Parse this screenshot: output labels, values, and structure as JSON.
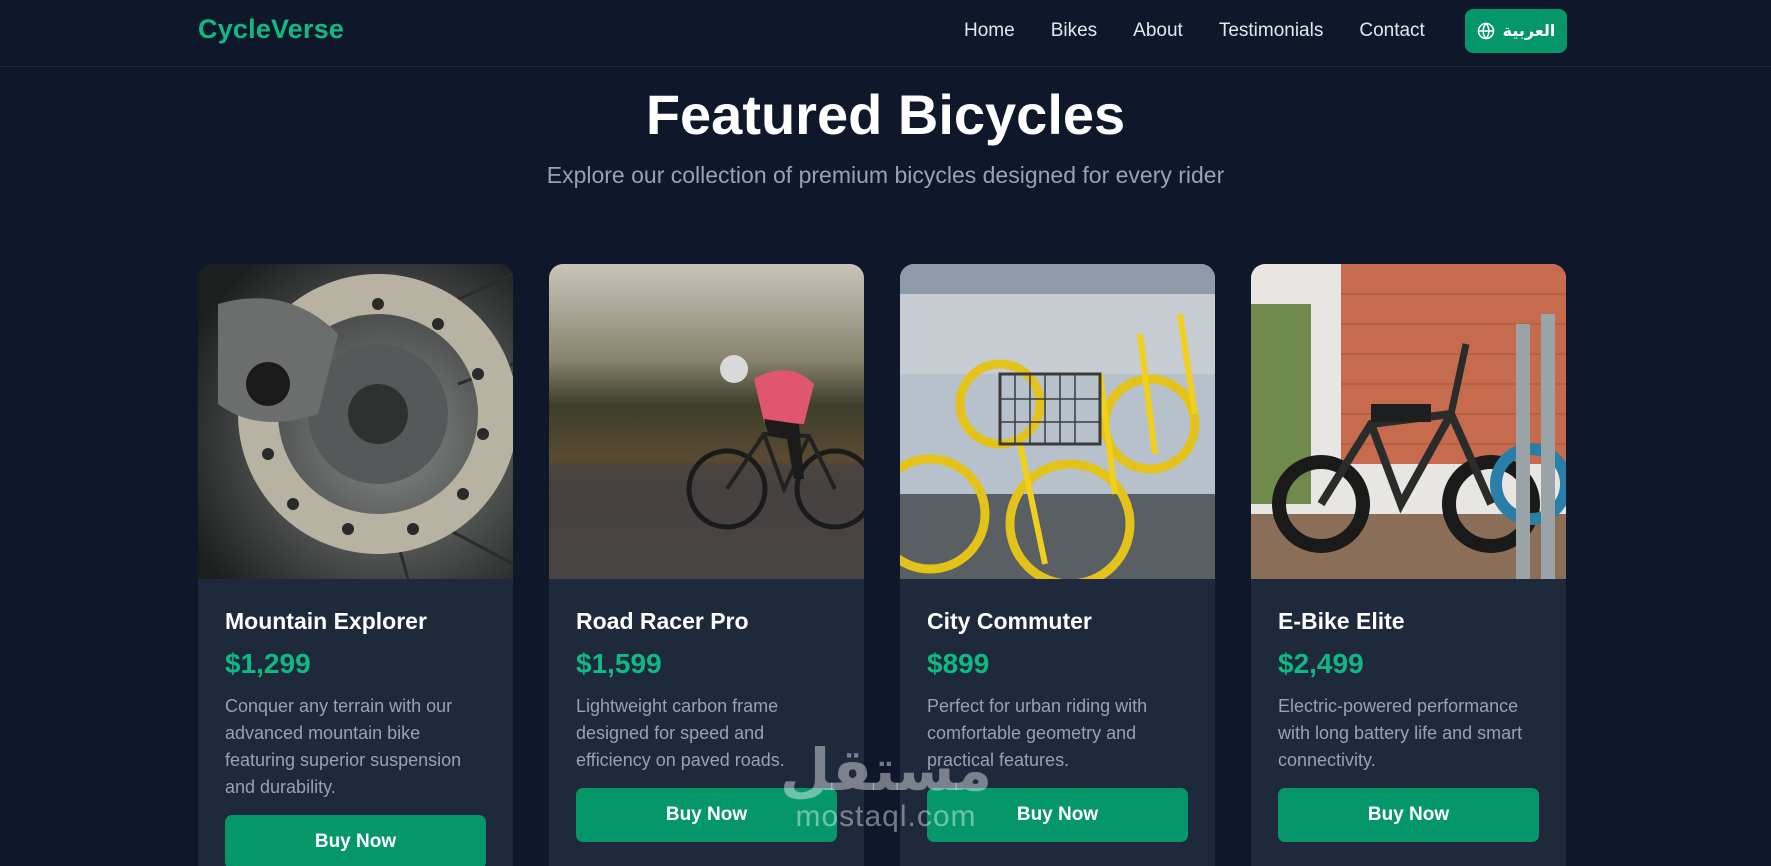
{
  "brand": {
    "name": "CycleVerse"
  },
  "nav": {
    "links": [
      "Home",
      "Bikes",
      "About",
      "Testimonials",
      "Contact"
    ],
    "language_button": {
      "label": "العربية",
      "icon": "globe-icon"
    }
  },
  "hero": {
    "title": "Featured Bicycles",
    "subtitle": "Explore our collection of premium bicycles designed for every rider"
  },
  "products": [
    {
      "name": "Mountain Explorer",
      "price": "$1,299",
      "description": "Conquer any terrain with our advanced mountain bike featuring superior suspension and durability.",
      "cta": "Buy Now",
      "image": "disc-brake-closeup"
    },
    {
      "name": "Road Racer Pro",
      "price": "$1,599",
      "description": "Lightweight carbon frame designed for speed and efficiency on paved roads.",
      "cta": "Buy Now",
      "image": "road-cyclist-motion"
    },
    {
      "name": "City Commuter",
      "price": "$899",
      "description": "Perfect for urban riding with comfortable geometry and practical features.",
      "cta": "Buy Now",
      "image": "yellow-city-bikes"
    },
    {
      "name": "E-Bike Elite",
      "price": "$2,499",
      "description": "Electric-powered performance with long battery life and smart connectivity.",
      "cta": "Buy Now",
      "image": "electric-bikes-parked"
    }
  ],
  "watermark": {
    "logo": "مستقل",
    "url": "mostaql.com"
  },
  "colors": {
    "background": "#0f172a",
    "card": "#1e293b",
    "accent": "#10b981",
    "button": "#059669",
    "muted_text": "#94a3b8"
  }
}
